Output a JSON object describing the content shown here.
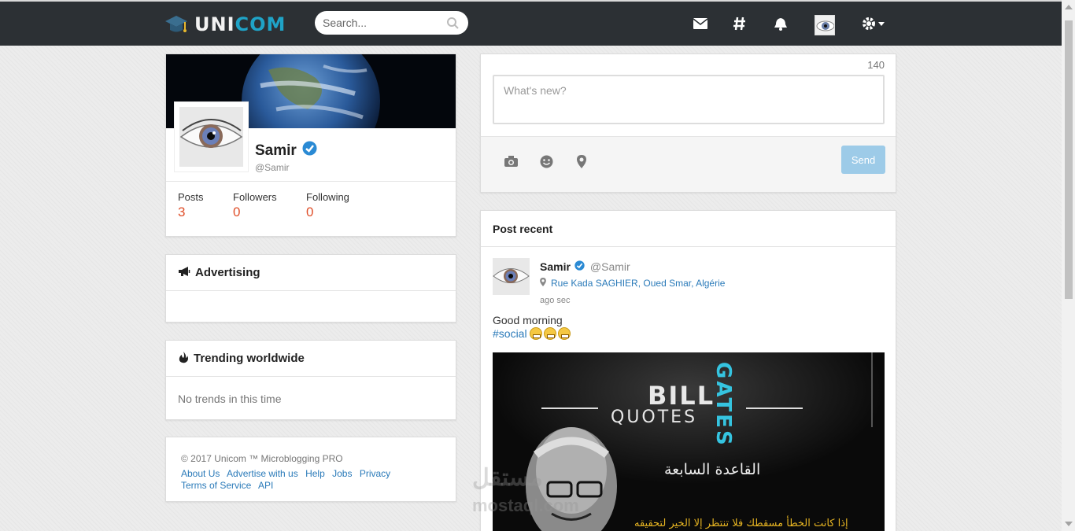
{
  "brand": {
    "part1": "UNI",
    "part2": "COM",
    "accent": "#1fa3c7"
  },
  "search": {
    "placeholder": "Search..."
  },
  "nav": {
    "icons": [
      "envelope-icon",
      "hashtag-icon",
      "bell-icon",
      "avatar",
      "gear-icon"
    ]
  },
  "profile": {
    "name": "Samir",
    "handle": "@Samir",
    "stats": [
      {
        "label": "Posts",
        "value": "3"
      },
      {
        "label": "Followers",
        "value": "0"
      },
      {
        "label": "Following",
        "value": "0"
      }
    ]
  },
  "advertising": {
    "title": "Advertising"
  },
  "trending": {
    "title": "Trending worldwide",
    "empty": "No trends in this time"
  },
  "footer": {
    "copyright": "© 2017 Unicom ™ Microblogging PRO",
    "links": [
      "About Us",
      "Advertise with us",
      "Help",
      "Jobs",
      "Privacy",
      "Terms of Service",
      "API"
    ]
  },
  "compose": {
    "char_count": "140",
    "placeholder": "What's new?",
    "send_label": "Send"
  },
  "posts": {
    "title": "Post recent",
    "items": [
      {
        "author": "Samir",
        "handle": "@Samir",
        "location": "Rue Kada SAGHIER, Oued Smar, Algérie",
        "time": "ago sec",
        "text": "Good morning",
        "hashtag": "#social",
        "image": {
          "title1": "BILL",
          "title2": "QUOTES",
          "title3": "GATES",
          "arabic1": "القاعدة السابعة",
          "arabic2": "إذا كانت الخطأ مسقطك فلا تنتظر إلا الخير لتحقيقه"
        }
      }
    ]
  },
  "watermark": {
    "line1": "مستقل",
    "line2": "mostaql.com"
  }
}
